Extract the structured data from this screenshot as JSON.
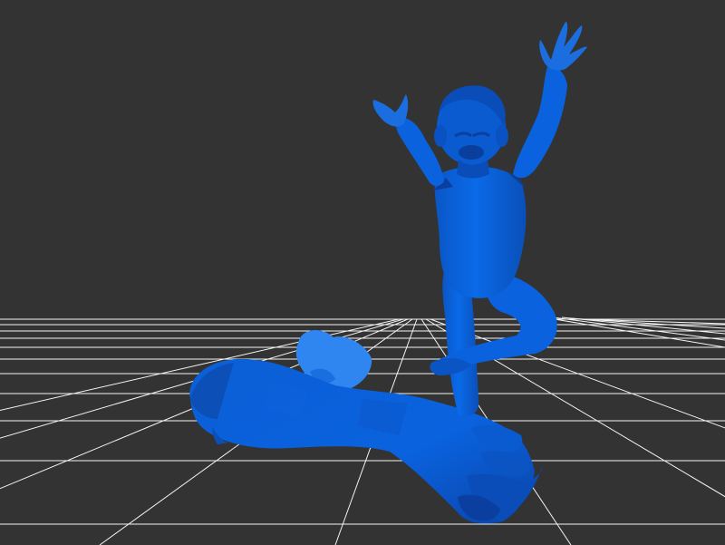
{
  "viewer": {
    "background_color": "#333333",
    "grid_color": "#ffffff",
    "model_color": "#0a66e0",
    "model_highlight": "#3d8cf5",
    "model_shadow": "#0a3f9e"
  },
  "scene": {
    "objects": [
      {
        "name": "child-figure"
      },
      {
        "name": "giant-hand"
      },
      {
        "name": "small-base-piece"
      }
    ]
  }
}
